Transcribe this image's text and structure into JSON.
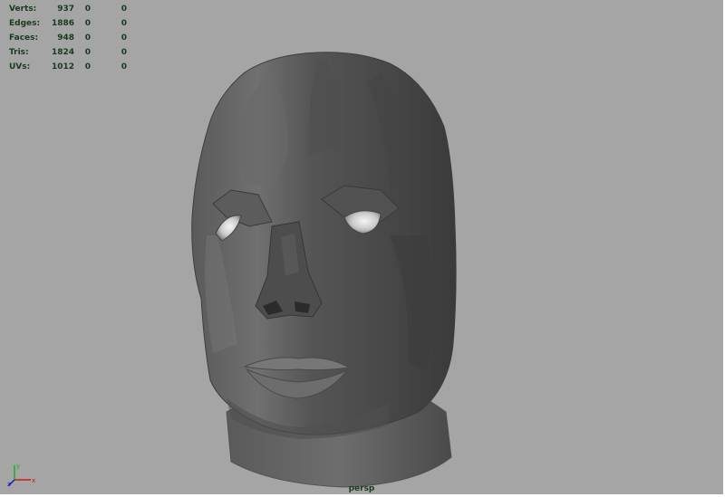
{
  "heads_up_display": {
    "rows": [
      {
        "label": "Verts:",
        "value": "937",
        "c2": "0",
        "c3": "0"
      },
      {
        "label": "Edges:",
        "value": "1886",
        "c2": "0",
        "c3": "0"
      },
      {
        "label": "Faces:",
        "value": "948",
        "c2": "0",
        "c3": "0"
      },
      {
        "label": "Tris:",
        "value": "1824",
        "c2": "0",
        "c3": "0"
      },
      {
        "label": "UVs:",
        "value": "1012",
        "c2": "0",
        "c3": "0"
      }
    ]
  },
  "viewport": {
    "camera_label": "persp",
    "background_color": "#a5a5a5",
    "hud_text_color": "#193b1c"
  },
  "axis_gizmo": {
    "x_label": "x",
    "y_label": "y",
    "z_label": "z",
    "x_color": "#d01818",
    "y_color": "#18b018",
    "z_color": "#1818d0"
  },
  "model": {
    "icon": "head-mesh"
  }
}
